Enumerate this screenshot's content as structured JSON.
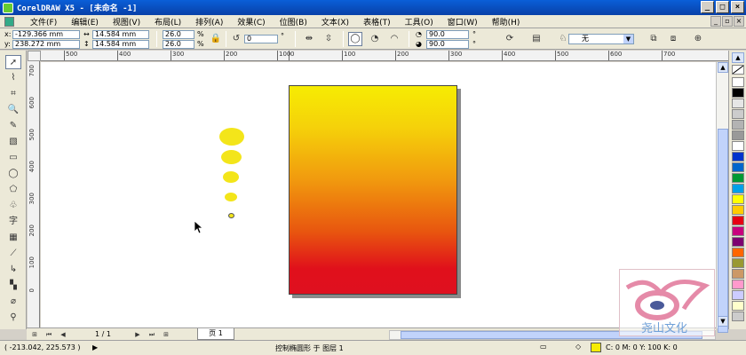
{
  "title": "CorelDRAW X5 - [未命名 -1]",
  "menu": [
    "文件(F)",
    "编辑(E)",
    "视图(V)",
    "布局(L)",
    "排列(A)",
    "效果(C)",
    "位图(B)",
    "文本(X)",
    "表格(T)",
    "工具(O)",
    "窗口(W)",
    "帮助(H)"
  ],
  "propbar": {
    "x": "-129.366 mm",
    "y": "238.272 mm",
    "width": "14.584 mm",
    "height": "14.584 mm",
    "scale_x": "26.0",
    "scale_y": "26.0",
    "percent": "%",
    "rotation": "0",
    "angle_start": "90.0",
    "angle_end": "90.0",
    "outline": "无"
  },
  "hruler_labels": [
    "500",
    "400",
    "300",
    "200",
    "100",
    "0",
    "100",
    "200",
    "300",
    "400",
    "500",
    "600",
    "700"
  ],
  "vruler_labels": [
    "700",
    "600",
    "500",
    "400",
    "300",
    "200",
    "100",
    "0"
  ],
  "pagebar": {
    "page_count": "1 / 1",
    "page_tab": "页 1"
  },
  "statusbar": {
    "coords": "( -213.042, 225.573 )",
    "message": "控制椭圆形 于 图层 1",
    "fill_info": "C: 0 M: 0 Y: 100 K: 0"
  },
  "watermark": "尧山文化",
  "colors": {
    "fill_swatch": "#f6ec02",
    "gradient_top": "#f6ec02",
    "gradient_bottom": "#df1020",
    "dots": "#f3e51a"
  },
  "palette": [
    "#ffffff",
    "#000000",
    "#e6e6e6",
    "#cccccc",
    "#b3b3b3",
    "#999999",
    "#ffffff",
    "#0033cc",
    "#0066cc",
    "#009933",
    "#00a0e9",
    "#ffff00",
    "#ffcc00",
    "#e60012",
    "#c8007d",
    "#7d0070",
    "#ff6600",
    "#999933",
    "#cc9966",
    "#ff99cc",
    "#ccccff",
    "#ffffcc",
    "#cccccc"
  ]
}
